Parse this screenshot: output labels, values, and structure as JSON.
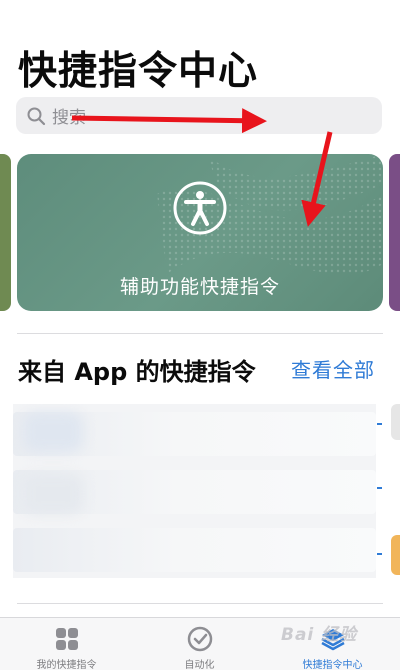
{
  "header": {
    "title": "快捷指令中心"
  },
  "search": {
    "placeholder": "搜索"
  },
  "featured": {
    "title": "辅助功能快捷指令",
    "color": "#5e8d7c"
  },
  "apps_section": {
    "title": "来自 App 的快捷指令",
    "see_all": "查看全部"
  },
  "tabs": [
    {
      "label": "我的快捷指令",
      "icon": "grid-icon",
      "active": false
    },
    {
      "label": "自动化",
      "icon": "checkmark-circle-icon",
      "active": false
    },
    {
      "label": "快捷指令中心",
      "icon": "layers-icon",
      "active": true
    }
  ],
  "watermark": "Bai 经验",
  "colors": {
    "accent": "#2f7bd6",
    "annotation_arrow": "#e8141c"
  }
}
